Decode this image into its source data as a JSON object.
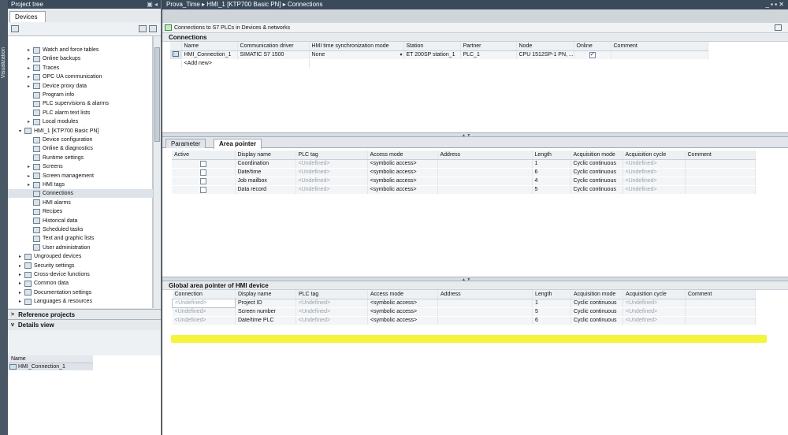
{
  "side_strip": {
    "label": "Visualization"
  },
  "project_tree": {
    "title": "Project tree",
    "devices_tab": "Devices",
    "items": [
      {
        "label": "Watch and force tables",
        "level": 2,
        "arrow": "▸"
      },
      {
        "label": "Online backups",
        "level": 2,
        "arrow": "▸"
      },
      {
        "label": "Traces",
        "level": 2,
        "arrow": "▸"
      },
      {
        "label": "OPC UA communication",
        "level": 2,
        "arrow": "▸"
      },
      {
        "label": "Device proxy data",
        "level": 2,
        "arrow": "▸"
      },
      {
        "label": "Program info",
        "level": 2,
        "arrow": ""
      },
      {
        "label": "PLC supervisions & alarms",
        "level": 2,
        "arrow": ""
      },
      {
        "label": "PLC alarm text lists",
        "level": 2,
        "arrow": ""
      },
      {
        "label": "Local modules",
        "level": 2,
        "arrow": "▸"
      },
      {
        "label": "HMI_1 [KTP700 Basic PN]",
        "level": 1,
        "arrow": "▾"
      },
      {
        "label": "Device configuration",
        "level": 2,
        "arrow": ""
      },
      {
        "label": "Online & diagnostics",
        "level": 2,
        "arrow": ""
      },
      {
        "label": "Runtime settings",
        "level": 2,
        "arrow": ""
      },
      {
        "label": "Screens",
        "level": 2,
        "arrow": "▸"
      },
      {
        "label": "Screen management",
        "level": 2,
        "arrow": "▸"
      },
      {
        "label": "HMI tags",
        "level": 2,
        "arrow": "▸"
      },
      {
        "label": "Connections",
        "level": 2,
        "arrow": "",
        "selected": true
      },
      {
        "label": "HMI alarms",
        "level": 2,
        "arrow": ""
      },
      {
        "label": "Recipes",
        "level": 2,
        "arrow": ""
      },
      {
        "label": "Historical data",
        "level": 2,
        "arrow": ""
      },
      {
        "label": "Scheduled tasks",
        "level": 2,
        "arrow": ""
      },
      {
        "label": "Text and graphic lists",
        "level": 2,
        "arrow": ""
      },
      {
        "label": "User administration",
        "level": 2,
        "arrow": ""
      },
      {
        "label": "Ungrouped devices",
        "level": 1,
        "arrow": "▸"
      },
      {
        "label": "Security settings",
        "level": 1,
        "arrow": "▸"
      },
      {
        "label": "Cross-device functions",
        "level": 1,
        "arrow": "▸"
      },
      {
        "label": "Common data",
        "level": 1,
        "arrow": "▸"
      },
      {
        "label": "Documentation settings",
        "level": 1,
        "arrow": "▸"
      },
      {
        "label": "Languages & resources",
        "level": 1,
        "arrow": "▸"
      }
    ],
    "reference_projects": "Reference projects",
    "details_view": "Details view",
    "details": {
      "column": "Name",
      "rows": [
        "HMI_Connection_1"
      ]
    }
  },
  "main": {
    "breadcrumb": "Prova_Time ▸ HMI_1 [KTP700 Basic PN] ▸ Connections",
    "window_controls": "_ ▪ ▪ ✕",
    "toolbar_text": "Connections to S7 PLCs in Devices & networks",
    "connections": {
      "title": "Connections",
      "columns": [
        "",
        "Name",
        "Communication driver",
        "HMI time synchronization mode",
        "Station",
        "Partner",
        "Node",
        "Online",
        "Comment"
      ],
      "rows": [
        {
          "name": "HMI_Connection_1",
          "driver": "SIMATIC S7 1500",
          "sync": "None",
          "station": "ET 200SP station_1",
          "partner": "PLC_1",
          "node": "CPU 1512SP-1 PN, ...",
          "online": true,
          "comment": ""
        }
      ],
      "add_new": "<Add new>"
    },
    "tabs": [
      "Parameter",
      "Area pointer"
    ],
    "area_pointer": {
      "columns": [
        "Active",
        "Display name",
        "PLC tag",
        "Access mode",
        "Address",
        "Length",
        "Acquisition mode",
        "Acquisition cycle",
        "Comment"
      ],
      "rows": [
        {
          "display": "Coordination",
          "tag": "<Undefined>",
          "access": "<symbolic access>",
          "address": "",
          "length": "1",
          "mode": "Cyclic continuous",
          "cycle": "<Undefined>"
        },
        {
          "display": "Date/time",
          "tag": "<Undefined>",
          "access": "<symbolic access>",
          "address": "",
          "length": "6",
          "mode": "Cyclic continuous",
          "cycle": "<Undefined>"
        },
        {
          "display": "Job mailbox",
          "tag": "<Undefined>",
          "access": "<symbolic access>",
          "address": "",
          "length": "4",
          "mode": "Cyclic continuous",
          "cycle": "<Undefined>"
        },
        {
          "display": "Data record",
          "tag": "<Undefined>",
          "access": "<symbolic access>",
          "address": "",
          "length": "5",
          "mode": "Cyclic continuous",
          "cycle": "<Undefined>"
        }
      ]
    },
    "global_area": {
      "title": "Global area pointer of HMI device",
      "columns": [
        "Connection",
        "Display name",
        "PLC tag",
        "Access mode",
        "Address",
        "Length",
        "Acquisition mode",
        "Acquisition cycle",
        "Comment"
      ],
      "rows": [
        {
          "conn": "<Undefined>",
          "display": "Project ID",
          "tag": "<Undefined>",
          "access": "<symbolic access>",
          "address": "",
          "length": "1",
          "mode": "Cyclic continuous",
          "cycle": "<Undefined>"
        },
        {
          "conn": "<Undefined>",
          "display": "Screen number",
          "tag": "<Undefined>",
          "access": "<symbolic access>",
          "address": "",
          "length": "5",
          "mode": "Cyclic continuous",
          "cycle": "<Undefined>"
        },
        {
          "conn": "<Undefined>",
          "display": "Date/time PLC",
          "tag": "<Undefined>",
          "access": "<symbolic access>",
          "address": "",
          "length": "6",
          "mode": "Cyclic continuous",
          "cycle": "<Undefined>"
        }
      ]
    },
    "highlight_color": "#f2f21b"
  }
}
